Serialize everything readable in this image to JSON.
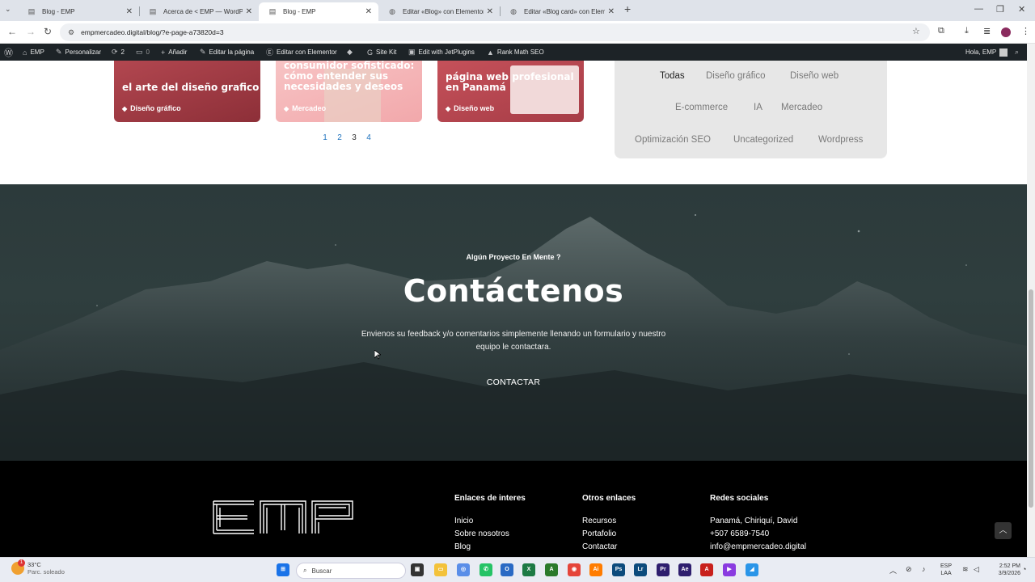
{
  "browser": {
    "tabs": [
      {
        "title": "Blog - EMP",
        "active": false
      },
      {
        "title": "Acerca de < EMP — WordPress",
        "active": false
      },
      {
        "title": "Blog - EMP",
        "active": true
      },
      {
        "title": "Editar «Blog» con Elementor",
        "active": false
      },
      {
        "title": "Editar «Blog card» con Elementor",
        "active": false
      }
    ],
    "url": "empmercadeo.digital/blog/?e-page-a73820d=3"
  },
  "wp_admin_bar": {
    "site": "EMP",
    "customize": "Personalizar",
    "updates_count": "2",
    "comments_count": "0",
    "add_new": "Añadir",
    "edit_page": "Editar la página",
    "edit_elementor": "Editar con Elementor",
    "site_kit": "Site Kit",
    "jetplugins": "Edit with JetPlugins",
    "rank_math": "Rank Math SEO",
    "greeting": "Hola, EMP"
  },
  "blog": {
    "cards": [
      {
        "title": "el arte del diseño grafico",
        "category": "Diseño gráfico",
        "bg": "#9b3a42"
      },
      {
        "title": "consumidor sofisticado: cómo entender sus necesidades y deseos",
        "category": "Mercadeo",
        "bg": "#f4b2b4"
      },
      {
        "title": "página web profesional en Panamá",
        "category": "Diseño web",
        "bg": "#c8535d"
      }
    ],
    "pages": [
      "1",
      "2",
      "3",
      "4"
    ],
    "current_page": "3"
  },
  "categories": {
    "items": [
      "Todas",
      "Diseño gráfico",
      "Diseño web",
      "E-commerce",
      "IA",
      "Mercadeo",
      "Optimización SEO",
      "Uncategorized",
      "Wordpress"
    ],
    "active": "Todas"
  },
  "contact": {
    "eyebrow": "Algún Proyecto En Mente ?",
    "title": "Contáctenos",
    "text": "Envienos su feedback y/o comentarios simplemente llenando un formulario y nuestro equipo le contactara.",
    "button": "CONTACTAR"
  },
  "footer": {
    "logo": "EMP",
    "col1": {
      "title": "Enlaces de interes",
      "links": [
        "Inicio",
        "Sobre nosotros",
        "Blog"
      ]
    },
    "col2": {
      "title": "Otros enlaces",
      "links": [
        "Recursos",
        "Portafolio",
        "Contactar"
      ]
    },
    "col3": {
      "title": "Redes sociales",
      "links": [
        "Panamá, Chiriquí, David",
        "+507 6589-7540",
        "info@empmercadeo.digital"
      ]
    }
  },
  "taskbar": {
    "temperature": "33°C",
    "weather": "Parc. soleado",
    "notif_count": "1",
    "search_placeholder": "Buscar",
    "lang": "ESP",
    "lang_sub": "LAA",
    "time": "2:52 PM",
    "date": "3/9/2026"
  }
}
